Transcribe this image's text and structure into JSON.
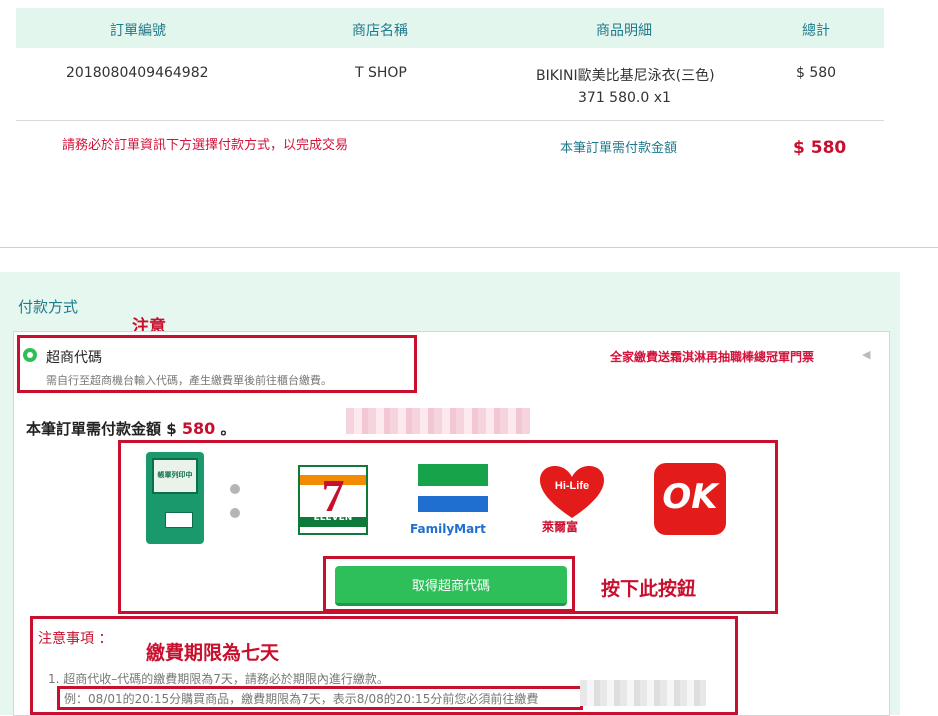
{
  "order_table": {
    "headers": [
      "訂單編號",
      "商店名稱",
      "商品明細",
      "總計"
    ],
    "row": {
      "order_no": "2018080409464982",
      "store": "T SHOP",
      "item_line1": "BIKINI歐美比基尼泳衣(三色)",
      "item_line2": "371 580.0 x1",
      "total": "$ 580"
    },
    "warning": "請務必於訂單資訊下方選擇付款方式，以完成交易",
    "due_label": "本筆訂單需付款金額",
    "due_amount": "$ 580"
  },
  "payment": {
    "title": "付款方式",
    "method_name": "超商代碼",
    "method_desc": "需自行至超商機台輸入代碼，產生繳費單後前往櫃台繳費。",
    "promo": "全家繳費送霜淇淋再抽職棒總冠軍門票",
    "amount_prefix": "本筆訂單需付款金額 $",
    "amount_value": "580",
    "amount_suffix": "。",
    "kiosk_label": "帳單列印中",
    "stores": {
      "seven_eleven": "ELEVEN",
      "familymart": "FamilyMart",
      "hilife_logo": "Hi-Life",
      "hilife": "萊爾富",
      "ok": "OK"
    },
    "get_code_button": "取得超商代碼",
    "notes_title": "注意事項 ：",
    "note1": "1. 超商代收–代碼的繳費期限為7天，請務必於期限內進行繳款。",
    "note_example": "例：08/01的20:15分購買商品，繳費期限為7天，表示8/08的20:15分前您必須前往繳費"
  },
  "annotations": {
    "attention": "注意",
    "press_button": "按下此按鈕",
    "deadline": "繳費期限為七天"
  },
  "colors": {
    "accent": "#1f7a8c",
    "annotation_red": "#c8102e",
    "button_green": "#2fbf5a",
    "panel_bg": "#e6f7ef"
  }
}
